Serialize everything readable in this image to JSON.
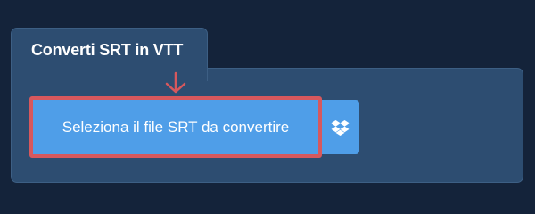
{
  "panel": {
    "title": "Converti SRT in VTT"
  },
  "upload": {
    "select_button_label": "Seleziona il file SRT da convertire",
    "dropbox_icon": "dropbox-icon"
  },
  "annotation": {
    "arrow_icon": "arrow-down-icon",
    "highlight_color": "#d7585d"
  },
  "colors": {
    "background": "#14233a",
    "panel": "#2d4d71",
    "button": "#4f9ee8",
    "text": "#ffffff"
  }
}
